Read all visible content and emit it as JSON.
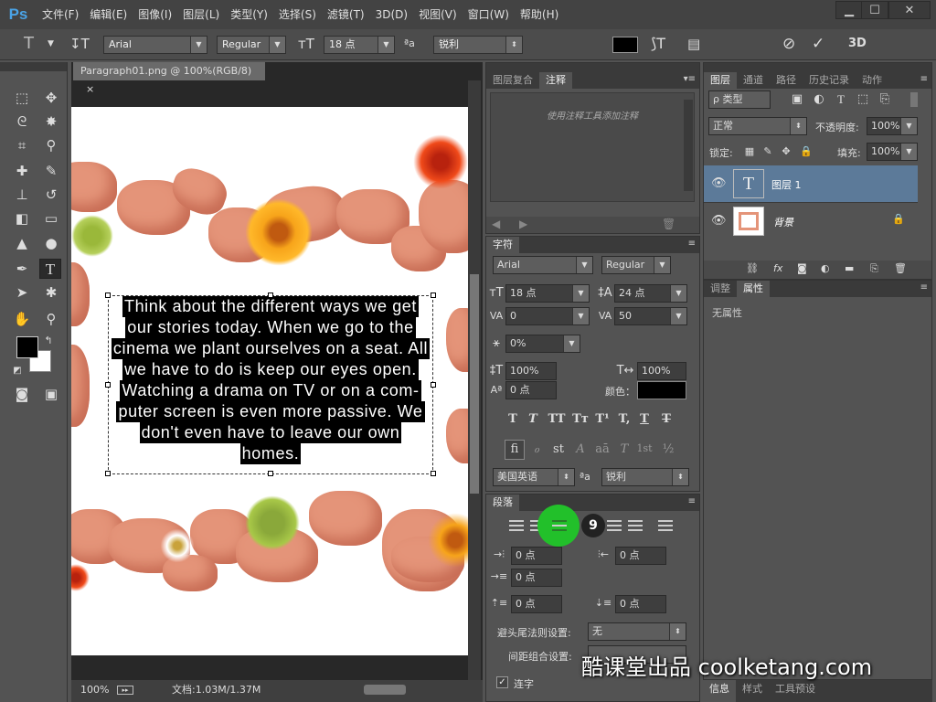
{
  "app": {
    "logo": "Ps"
  },
  "menu": [
    "文件(F)",
    "编辑(E)",
    "图像(I)",
    "图层(L)",
    "类型(Y)",
    "选择(S)",
    "滤镜(T)",
    "3D(D)",
    "视图(V)",
    "窗口(W)",
    "帮助(H)"
  ],
  "window_controls": {
    "minimize": "▁",
    "restore": "☐",
    "close": "✕"
  },
  "options": {
    "font_family": "Arial",
    "font_style": "Regular",
    "font_size": "18 点",
    "aa_label": "ªa",
    "antialias": "锐利",
    "color": "#000000",
    "threed": "3D"
  },
  "document": {
    "tab_title": "Paragraph01.png @ 100%(RGB/8)",
    "close": "×",
    "text_lines": [
      "Think about the different ways we get",
      "our stories today. When we go to the",
      "cinema we plant ourselves on a seat. All",
      "we have to do is keep our eyes open.",
      "Watching a drama on TV or on a com-",
      "puter screen is even more passive. We",
      "don't even have to leave our own",
      "homes."
    ],
    "zoom": "100%",
    "doc_size": "文档:1.03M/1.37M"
  },
  "notes_panel": {
    "tabs": [
      "图层复合",
      "注释"
    ],
    "placeholder": "使用注释工具添加注释"
  },
  "character_panel": {
    "tab": "字符",
    "font_family": "Arial",
    "font_style": "Regular",
    "size": "18 点",
    "leading": "24 点",
    "kerning": "0",
    "tracking": "50",
    "scale_pct": "0%",
    "vertical_scale": "100%",
    "horizontal_scale": "100%",
    "baseline": "0 点",
    "color_label": "颜色：",
    "color": "#000000",
    "language": "美国英语",
    "aa_label": "ªa",
    "antialias": "锐利",
    "style_glyphs": [
      "T",
      "T",
      "TT",
      "Tт",
      "T¹",
      "T,",
      "T",
      "T"
    ],
    "ot_glyphs": [
      "fi",
      "ℴ",
      "st",
      "A",
      "aā",
      "T",
      "1st",
      "½"
    ]
  },
  "paragraph_panel": {
    "tab": "段落",
    "step_badge": "9",
    "indent_left": "0 点",
    "indent_right": "0 点",
    "indent_first": "0 点",
    "space_before": "0 点",
    "space_after": "0 点",
    "kinsoku_label": "避头尾法则设置:",
    "kinsoku_value": "无",
    "mojikumi_label": "间距组合设置:",
    "hyphenate_label": "连字"
  },
  "layers_panel": {
    "tabs": [
      "图层",
      "通道",
      "路径",
      "历史记录",
      "动作"
    ],
    "filter_kind": "ρ 类型",
    "blend_mode": "正常",
    "opacity_label": "不透明度:",
    "opacity": "100%",
    "lock_label": "锁定:",
    "fill_label": "填充:",
    "fill": "100%",
    "layers": [
      {
        "name": "图层 1",
        "thumb": "T",
        "selected": true
      },
      {
        "name": "背景",
        "locked": true
      }
    ]
  },
  "properties_panel": {
    "tabs": [
      "调整",
      "属性"
    ],
    "empty": "无属性"
  },
  "bottom_tabs": [
    "信息",
    "样式",
    "工具预设"
  ],
  "watermark": "酷课堂出品 coolketang.com",
  "colors": {
    "chrome": "#535353",
    "menubar": "#434343",
    "selection": "#5c7a99",
    "accent_green": "#22c02a"
  }
}
